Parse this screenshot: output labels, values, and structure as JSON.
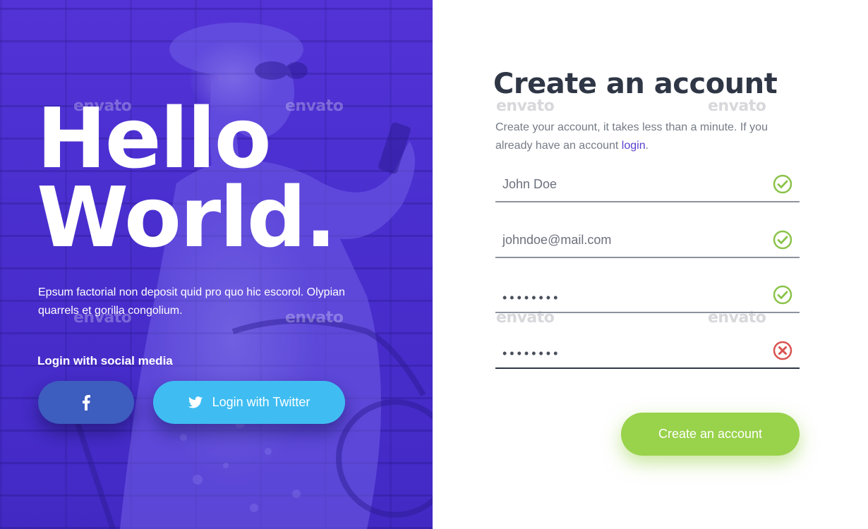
{
  "hero": {
    "line1": "Hello",
    "line2": "World.",
    "tagline": "Epsum factorial non deposit quid pro quo hic escorol. Olypian quarrels et gorilla congolium."
  },
  "social": {
    "label": "Login with social media",
    "facebook_icon": "facebook-icon",
    "twitter_icon": "twitter-icon",
    "twitter_label": "Login with Twitter",
    "facebook_color": "#3d5dbf",
    "twitter_color": "#3fbdf2"
  },
  "form": {
    "title": "Create an account",
    "subtitle_prefix": "Create your account, it takes less than a minute. If you already have an account ",
    "login_link": "login",
    "subtitle_suffix": ".",
    "fields": [
      {
        "value": "John Doe",
        "status": "valid"
      },
      {
        "value": "johndoe@mail.com",
        "status": "valid"
      },
      {
        "value": "••••••••",
        "status": "valid"
      },
      {
        "value": "••••••••",
        "status": "invalid"
      }
    ],
    "submit_label": "Create an account"
  },
  "watermark": {
    "text": "envato"
  },
  "colors": {
    "accent": "#5333d6",
    "valid": "#8bc34a",
    "invalid": "#d9534f",
    "submit": "#99d24b",
    "heading": "#2f3645"
  }
}
